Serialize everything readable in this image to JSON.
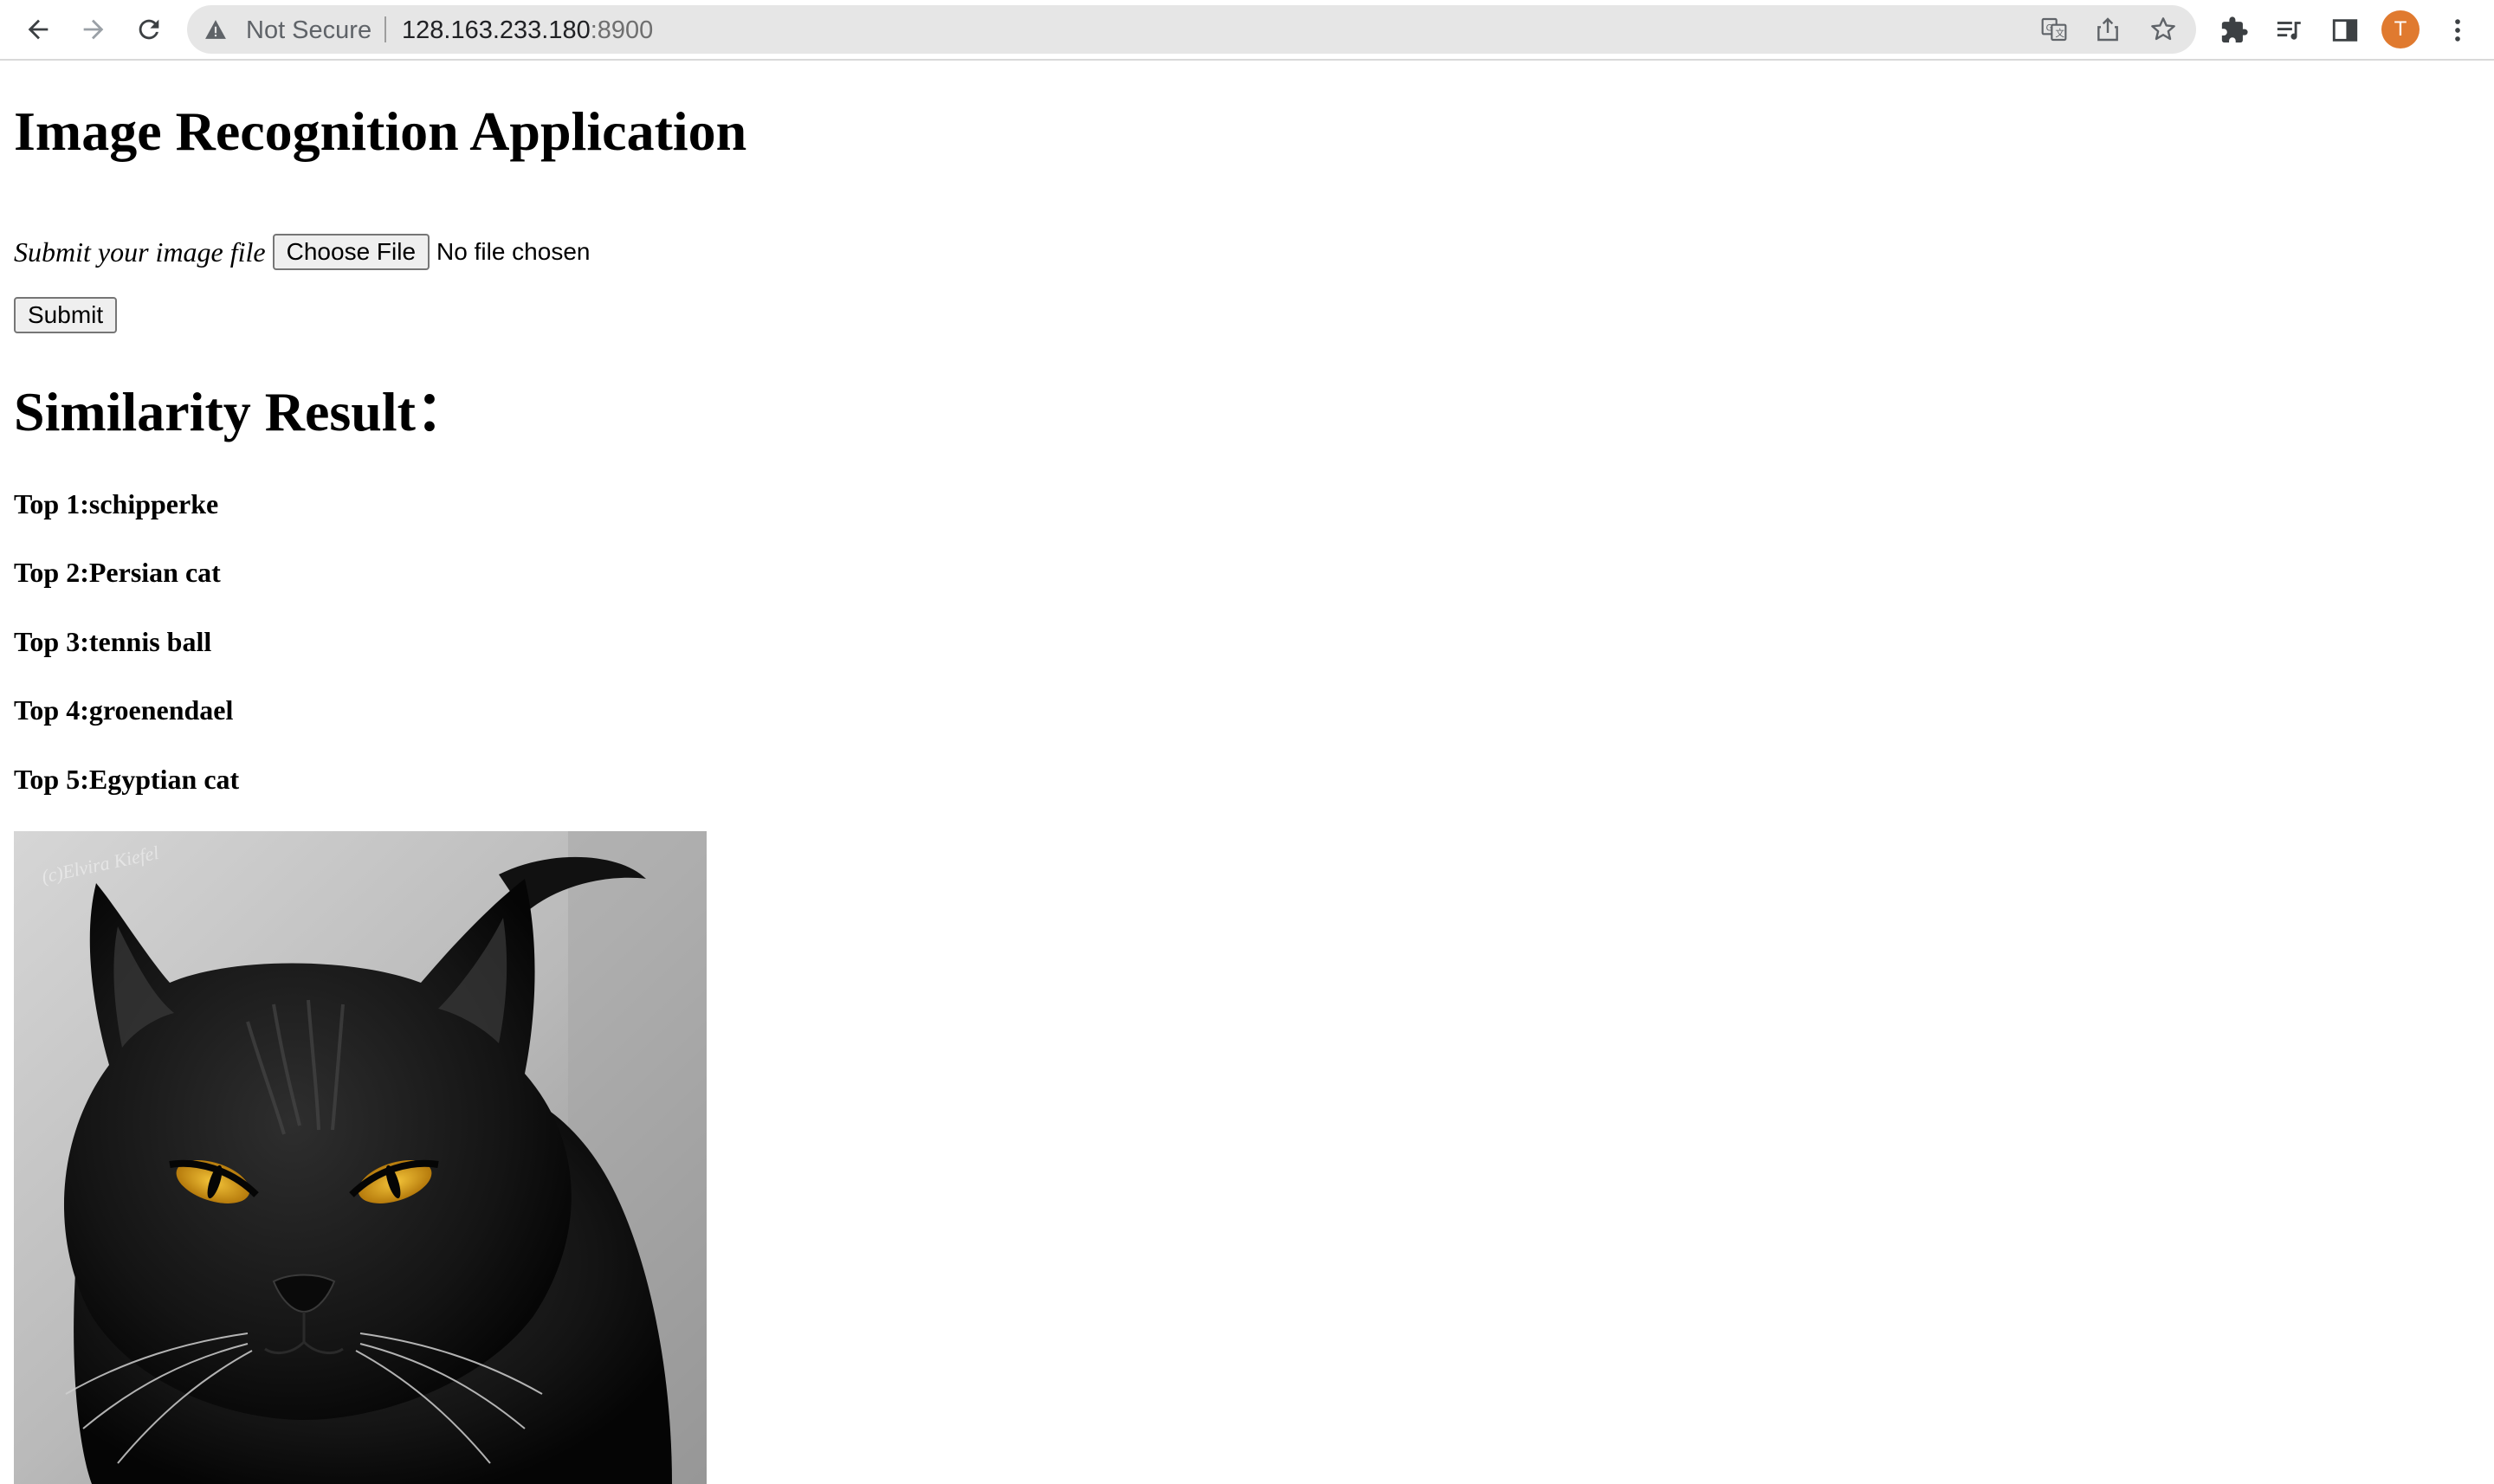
{
  "browser": {
    "security_label": "Not Secure",
    "url_host": "128.163.233.180",
    "url_port": ":8900",
    "avatar_initial": "T",
    "avatar_color": "#e07a2f"
  },
  "page": {
    "title": "Image Recognition Application",
    "upload": {
      "label": "Submit your image file",
      "choose_button": "Choose File",
      "status": "No file chosen"
    },
    "submit_label": "Submit",
    "results_heading": "Similarity Result：",
    "results": [
      "Top 1:schipperke",
      "Top 2:Persian cat",
      "Top 3:tennis ball",
      "Top 4:groenendael",
      "Top 5:Egyptian cat"
    ],
    "image": {
      "watermark": "(c)Elvira Kiefel",
      "eye_color": "#e0a21a"
    }
  }
}
